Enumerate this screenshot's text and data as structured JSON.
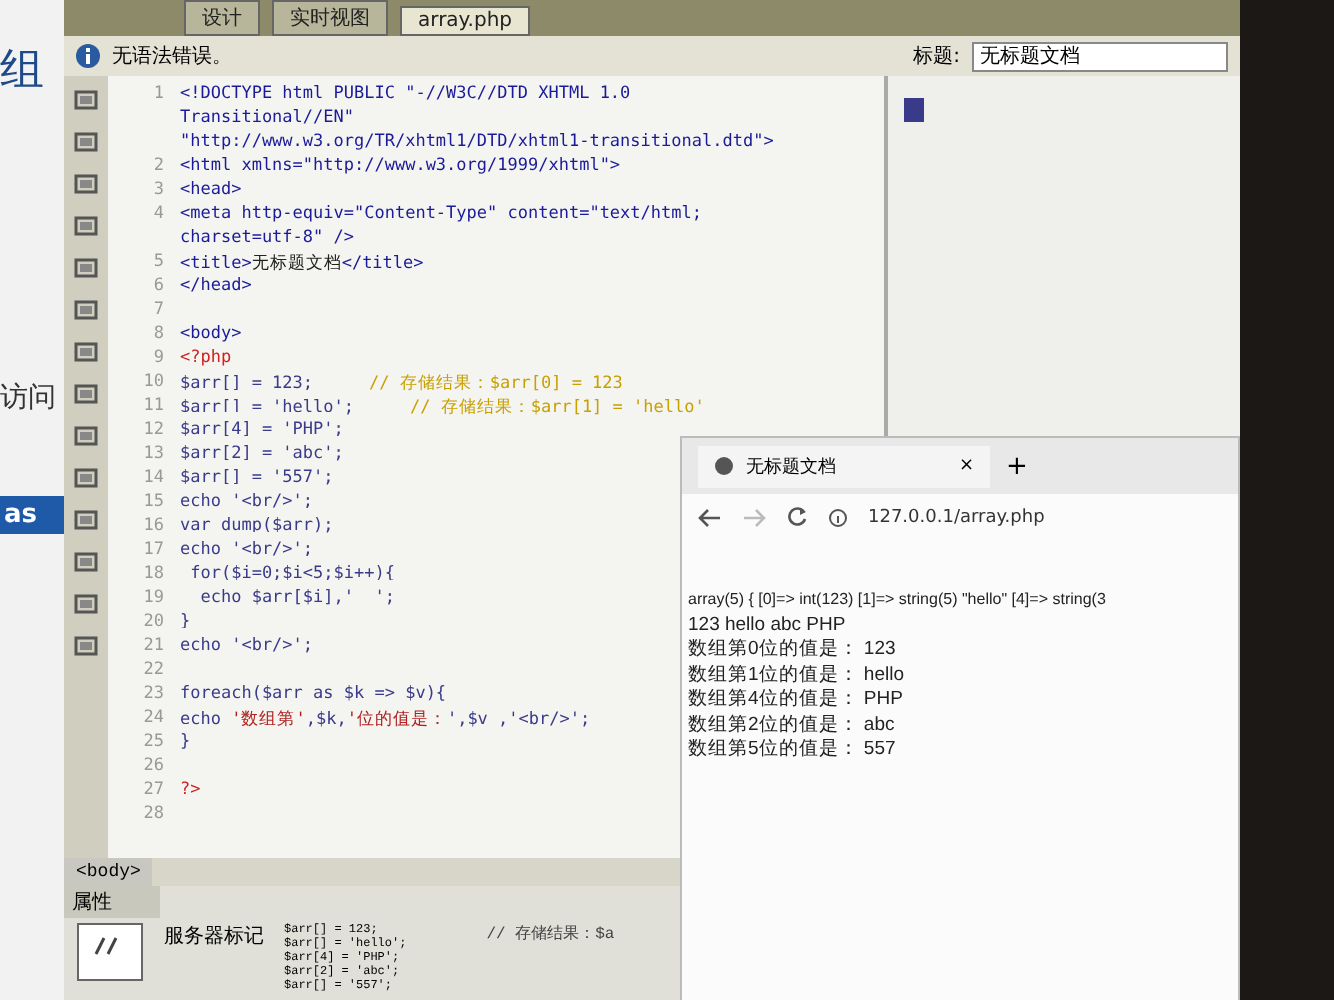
{
  "left_page": {
    "heading": "组",
    "text": "访问",
    "badge": "as"
  },
  "toolbar": {
    "tabs": [
      {
        "label": "设计",
        "selected": false
      },
      {
        "label": "实时视图",
        "selected": false
      }
    ],
    "file_tab": "array.php",
    "title_label": "标题:",
    "title_value": "无标题文档"
  },
  "info_bar": {
    "message": "无语法错误。"
  },
  "code_lines": [
    {
      "number": "1",
      "segments": [
        {
          "kind": "tag",
          "text": "<!DOCTYPE html PUBLIC \"-//W3C//DTD XHTML 1.0"
        }
      ]
    },
    {
      "segments": [
        {
          "kind": "tag",
          "text": "Transitional//EN\""
        }
      ]
    },
    {
      "segments": [
        {
          "kind": "tag",
          "text": "\"http://www.w3.org/TR/xhtml1/DTD/xhtml1-transitional.dtd\">"
        }
      ]
    },
    {
      "number": "2",
      "segments": [
        {
          "kind": "tag",
          "text": "<html xmlns=\"http://www.w3.org/1999/xhtml\">"
        }
      ]
    },
    {
      "number": "3",
      "segments": [
        {
          "kind": "tag",
          "text": "<head>"
        }
      ]
    },
    {
      "number": "4",
      "segments": [
        {
          "kind": "tag",
          "text": "<meta http-equiv=\"Content-Type\" content=\"text/html;"
        }
      ]
    },
    {
      "segments": [
        {
          "kind": "tag",
          "text": "charset=utf-8\" />"
        }
      ]
    },
    {
      "number": "5",
      "segments": [
        {
          "kind": "tag",
          "text": "<title>"
        },
        {
          "kind": "plain",
          "text": "无标题文档"
        },
        {
          "kind": "tag",
          "text": "</title>"
        }
      ]
    },
    {
      "number": "6",
      "segments": [
        {
          "kind": "tag",
          "text": "</head>"
        }
      ]
    },
    {
      "number": "7"
    },
    {
      "number": "8",
      "segments": [
        {
          "kind": "tag",
          "text": "<body>"
        }
      ]
    },
    {
      "number": "9",
      "segments": [
        {
          "kind": "php",
          "text": "<?php"
        }
      ]
    },
    {
      "number": "10",
      "segments": [
        {
          "kind": "code",
          "text": "$arr[] = 123;"
        },
        {
          "kind": "comment",
          "text": "// 存储结果：$arr[0] = 123"
        }
      ]
    },
    {
      "number": "11",
      "segments": [
        {
          "kind": "code",
          "text": "$arr[] = 'hello';"
        },
        {
          "kind": "comment",
          "text": "// 存储结果：$arr[1] = 'hello'"
        }
      ]
    },
    {
      "number": "12",
      "segments": [
        {
          "kind": "code",
          "text": "$arr[4] = 'PHP';"
        }
      ]
    },
    {
      "number": "13",
      "segments": [
        {
          "kind": "code",
          "text": "$arr[2] = 'abc';"
        }
      ]
    },
    {
      "number": "14",
      "segments": [
        {
          "kind": "code",
          "text": "$arr[] = '557';"
        }
      ]
    },
    {
      "number": "15",
      "segments": [
        {
          "kind": "code",
          "text": "echo '<br/>';"
        }
      ]
    },
    {
      "number": "16",
      "segments": [
        {
          "kind": "code",
          "text": "var_dump($arr);"
        }
      ]
    },
    {
      "number": "17",
      "segments": [
        {
          "kind": "code",
          "text": "echo '<br/>';"
        }
      ]
    },
    {
      "number": "18",
      "segments": [
        {
          "kind": "code",
          "text": " for($i=0;$i<5;$i++){"
        }
      ]
    },
    {
      "number": "19",
      "segments": [
        {
          "kind": "code",
          "text": "  echo $arr[$i],'  ';"
        }
      ]
    },
    {
      "number": "20",
      "segments": [
        {
          "kind": "code",
          "text": "}"
        }
      ]
    },
    {
      "number": "21",
      "segments": [
        {
          "kind": "code",
          "text": "echo '<br/>';"
        }
      ]
    },
    {
      "number": "22"
    },
    {
      "number": "23",
      "segments": [
        {
          "kind": "code",
          "text": "foreach($arr as $k => $v){"
        }
      ]
    },
    {
      "number": "24",
      "segments": [
        {
          "kind": "code",
          "text": "echo "
        },
        {
          "kind": "string",
          "text": "'数组第'"
        },
        {
          "kind": "code",
          "text": ",$k,"
        },
        {
          "kind": "string",
          "text": "'位的值是："
        },
        {
          "kind": "code",
          "text": "',$v ,'<br/>';"
        }
      ]
    },
    {
      "number": "25",
      "segments": [
        {
          "kind": "code",
          "text": "}"
        }
      ]
    },
    {
      "number": "26"
    },
    {
      "number": "27",
      "segments": [
        {
          "kind": "php",
          "text": "?>"
        }
      ]
    },
    {
      "number": "28"
    }
  ],
  "tag_selector": "<body>",
  "properties": {
    "tab": "属性",
    "label": "服务器标记",
    "preview": [
      "$arr[] = 123;",
      "$arr[] = 'hello';",
      "$arr[4] = 'PHP';",
      "$arr[2] = 'abc';",
      "$arr[] = '557';"
    ],
    "comment": "// 存储结果：$a"
  },
  "browser": {
    "tab_title": "无标题文档",
    "close": "×",
    "new_tab": "+",
    "url": "127.0.0.1/array.php",
    "lines": [
      "array(5) { [0]=> int(123) [1]=> string(5) \"hello\" [4]=> string(3",
      "123 hello abc PHP",
      "数组第0位的值是：  123",
      "数组第1位的值是：  hello",
      "数组第4位的值是：  PHP",
      "数组第2位的值是：  abc",
      "数组第5位的值是：  557"
    ]
  }
}
